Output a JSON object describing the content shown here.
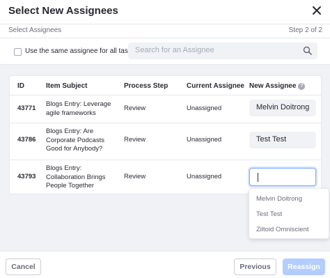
{
  "header": {
    "title": "Select New Assignees"
  },
  "subbar": {
    "left": "Select Assignees",
    "right": "Step 2 of 2"
  },
  "toolbar": {
    "same_assignee_label": "Use the same assignee for all tasks.",
    "search_placeholder": "Search for an Assignee"
  },
  "table": {
    "headers": [
      "ID",
      "Item Subject",
      "Process Step",
      "Current Assignee",
      "New Assignee"
    ],
    "rows": [
      {
        "id": "43771",
        "subject_line1": "Blogs Entry: Leverage",
        "subject_line2": "agile frameworks",
        "subject_line3": "",
        "step": "Review",
        "current": "Unassigned",
        "new": "Melvin Doitrong"
      },
      {
        "id": "43786",
        "subject_line1": "Blogs Entry: Are",
        "subject_line2": "Corporate Podcasts",
        "subject_line3": "Good for Anybody?",
        "step": "Review",
        "current": "Unassigned",
        "new": "Test Test"
      },
      {
        "id": "43793",
        "subject_line1": "Blogs Entry:",
        "subject_line2": "Collaboration Brings",
        "subject_line3": "People Together",
        "step": "Review",
        "current": "Unassigned",
        "new": ""
      }
    ]
  },
  "dropdown": {
    "options": [
      "Melvin Doitrong",
      "Test Test",
      "Ziltoid Omniscient"
    ]
  },
  "footer": {
    "cancel": "Cancel",
    "previous": "Previous",
    "reassign": "Reassign"
  },
  "icons": {
    "close": "close-icon",
    "search": "search-icon",
    "help": "help-icon"
  },
  "colors": {
    "accent": "#80acff",
    "disabled_primary": "#b3cdff",
    "muted": "#6b6c7e"
  }
}
